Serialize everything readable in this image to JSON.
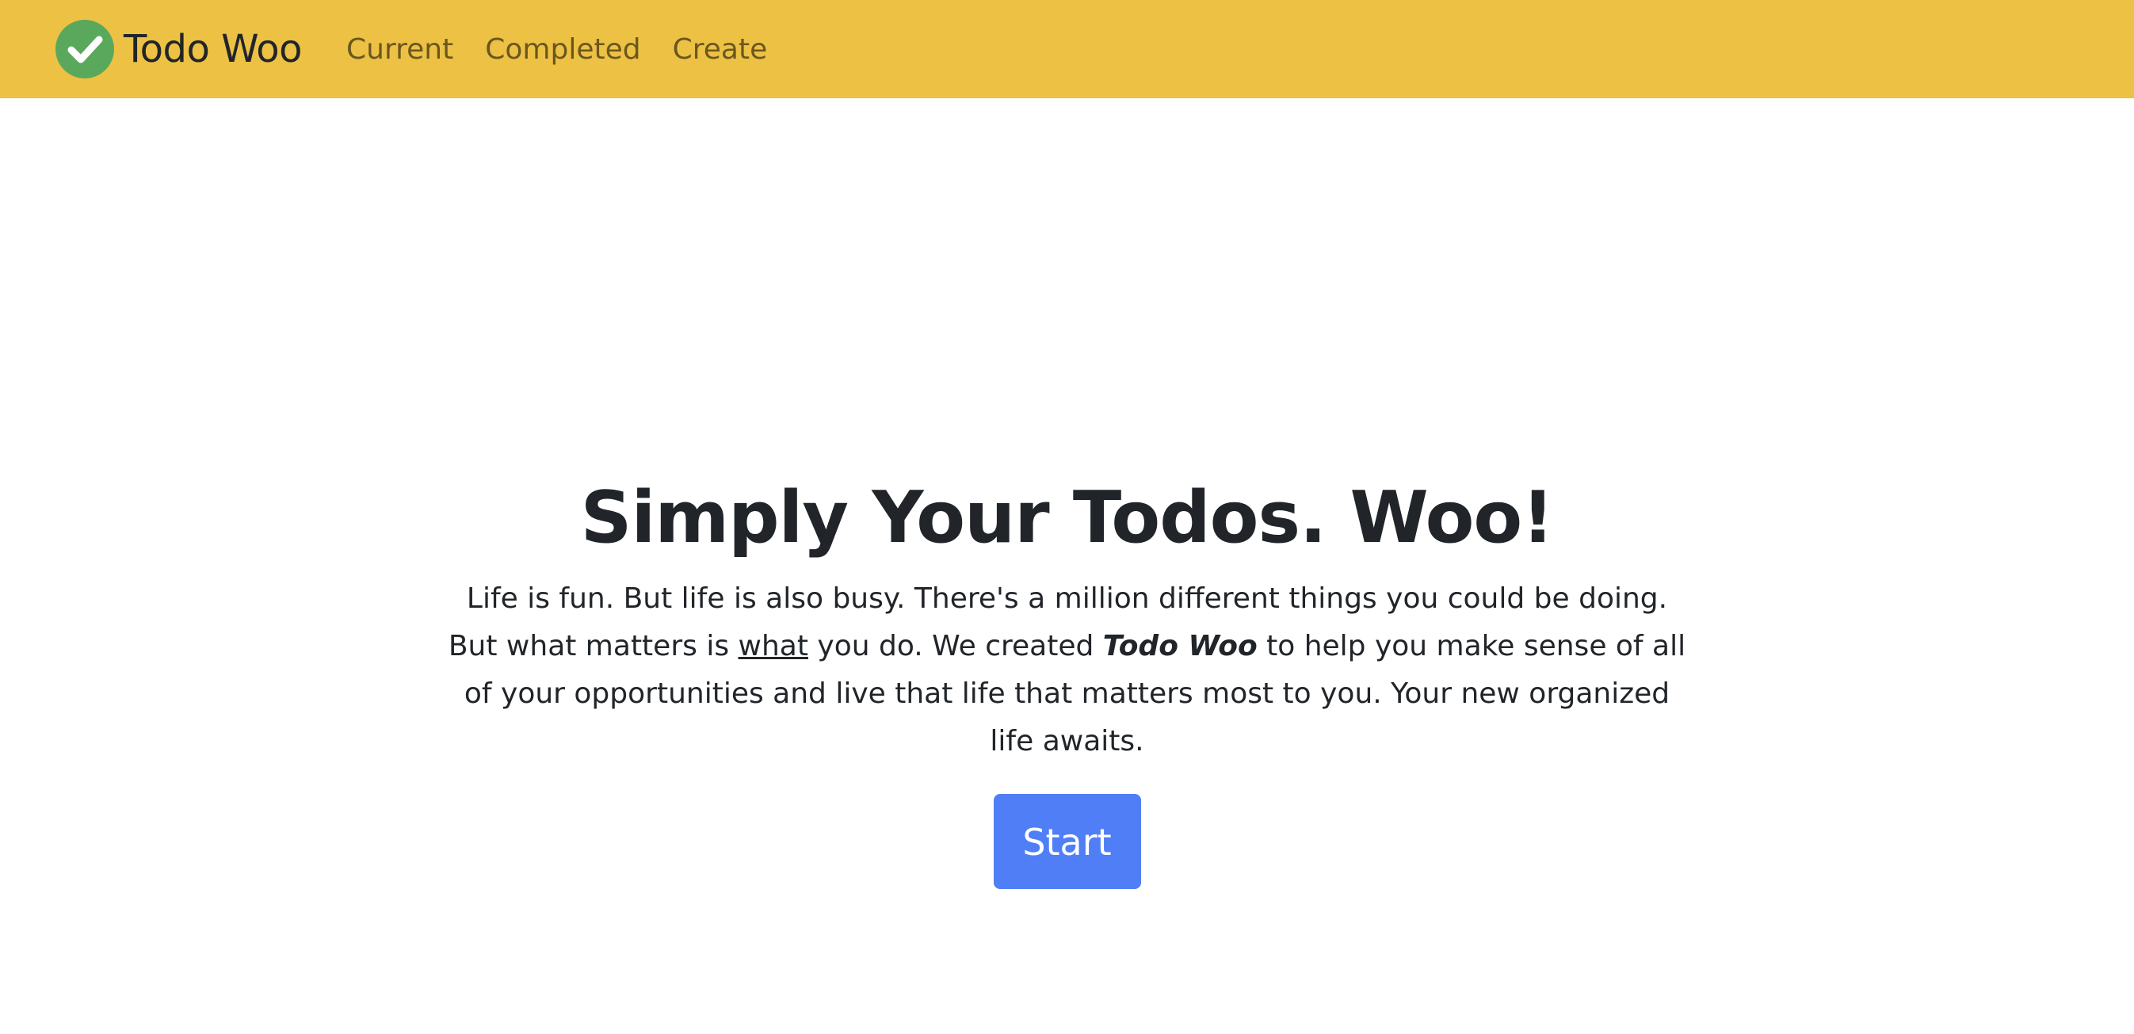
{
  "navbar": {
    "brand_name": "Todo Woo",
    "links": [
      "Current",
      "Completed",
      "Create"
    ],
    "background_color": "#ecc144",
    "logo_icon": "check-circle-icon",
    "logo_color": "#5aa85c"
  },
  "hero": {
    "title": "Simply Your Todos. Woo!",
    "paragraph": {
      "part1": "Life is fun. But life is also busy. There's a million different things you could be doing. But what matters is ",
      "underlined": "what",
      "part2": " you do. We created ",
      "emphasis": "Todo Woo",
      "part3": " to help you make sense of all of your opportunities and live that life that matters most to you. Your new organized life awaits."
    },
    "start_button_label": "Start",
    "button_color": "#4f7ef6"
  }
}
